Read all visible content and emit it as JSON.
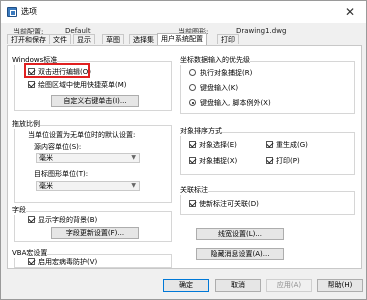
{
  "window": {
    "title": "选项"
  },
  "info": {
    "current_profile_label": "当前配置:",
    "current_profile_value": "Default",
    "current_drawing_label": "当前图形:",
    "current_drawing_value": "Drawing1.dwg"
  },
  "tabs": [
    "打开和保存",
    "文件",
    "显示",
    "草图",
    "选择集",
    "用户系统配置",
    "打印"
  ],
  "active_tab": "用户系统配置",
  "windows_std": {
    "title": "Windows标准",
    "double_click_edit": "双击进行编辑(O)",
    "shortcut_menu": "绘图区域中使用快捷菜单(M)",
    "custom_right_click_button": "自定义右键单击(I)..."
  },
  "insert_scale": {
    "title": "拖放比例",
    "subtitle": "当单位设置为无单位时的默认设置:",
    "source_label": "源内容单位(S):",
    "source_value": "毫米",
    "target_label": "目标图形单位(T):",
    "target_value": "毫米"
  },
  "fields": {
    "title": "字段",
    "show_background": "显示字段的背景(B)",
    "update_settings_button": "字段更新设置(F)..."
  },
  "vba": {
    "title": "VBA宏设置",
    "enable_macro_virus": "启用宏病毒防护(V)"
  },
  "coord_priority": {
    "title": "坐标数据输入的优先级",
    "options": [
      "执行对象捕捉(R)",
      "键盘输入(K)",
      "键盘输入, 脚本例外(X)"
    ],
    "selected_index": 2
  },
  "object_sort": {
    "title": "对象排序方式",
    "object_select": "对象选择(E)",
    "regen": "重生成(G)",
    "object_snap": "对象捕捉(X)",
    "print": "打印(P)"
  },
  "associative_dim": {
    "title": "关联标注",
    "make_new_dims_assoc": "使新标注可关联(D)"
  },
  "buttons": {
    "lineweight_settings": "线宽设置(L)...",
    "hidden_messages": "隐藏消息设置(A)...",
    "ok": "确定",
    "cancel": "取消",
    "apply": "应用(A)",
    "help": "帮助(H)"
  },
  "colors": {
    "highlight": "#e02020",
    "accent": "#0078d7"
  }
}
